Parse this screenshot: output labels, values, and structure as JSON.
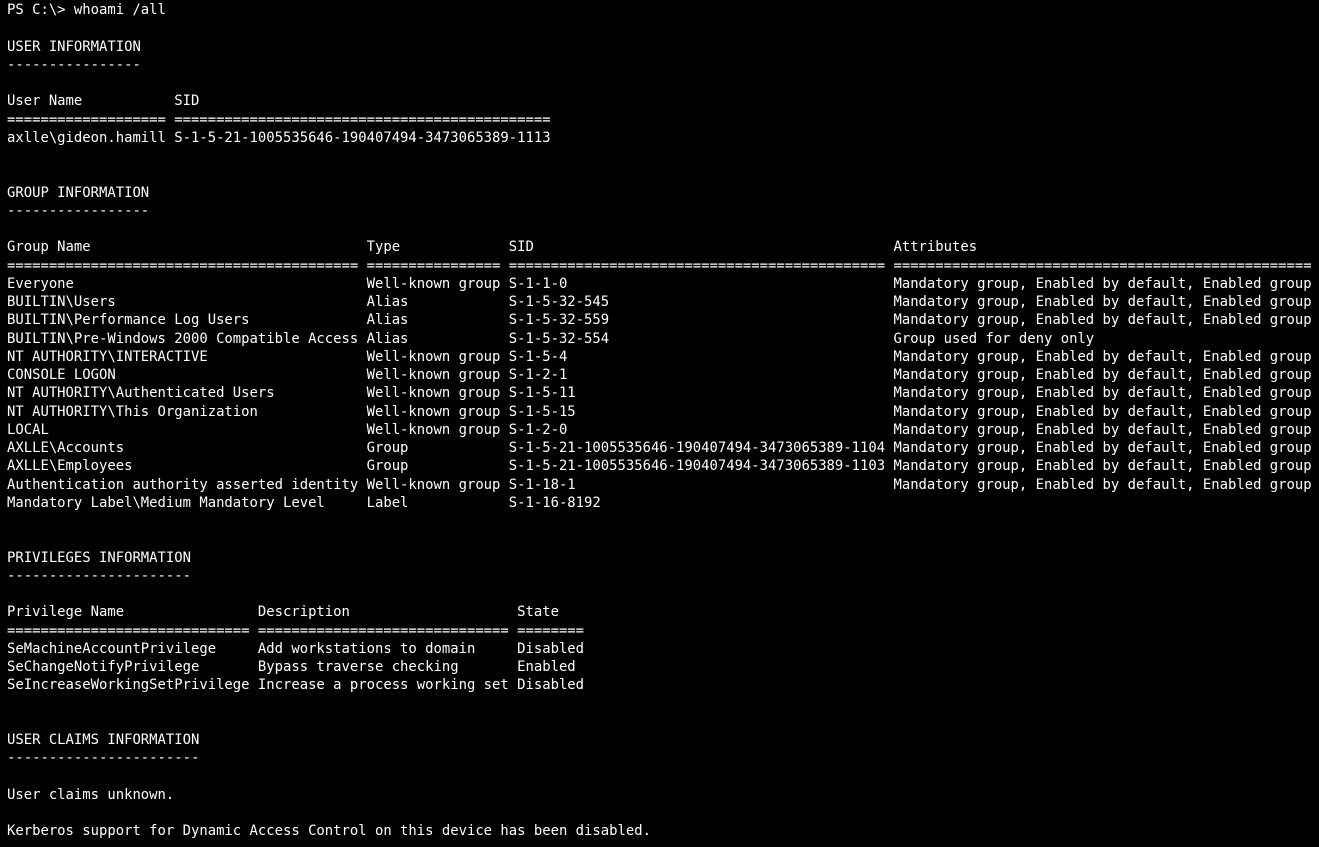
{
  "theme": {
    "background": "#000000",
    "foreground": "#ffffff"
  },
  "lines": [
    "PS C:\\> whoami /all",
    "",
    "USER INFORMATION",
    "----------------",
    "",
    "User Name           SID",
    "=================== =============================================",
    "axlle\\gideon.hamill S-1-5-21-1005535646-190407494-3473065389-1113",
    "",
    "",
    "GROUP INFORMATION",
    "-----------------",
    "",
    "Group Name                                 Type             SID                                           Attributes",
    "========================================== ================ ============================================= ==================================================",
    "Everyone                                   Well-known group S-1-1-0                                       Mandatory group, Enabled by default, Enabled group",
    "BUILTIN\\Users                              Alias            S-1-5-32-545                                  Mandatory group, Enabled by default, Enabled group",
    "BUILTIN\\Performance Log Users              Alias            S-1-5-32-559                                  Mandatory group, Enabled by default, Enabled group",
    "BUILTIN\\Pre-Windows 2000 Compatible Access Alias            S-1-5-32-554                                  Group used for deny only",
    "NT AUTHORITY\\INTERACTIVE                   Well-known group S-1-5-4                                       Mandatory group, Enabled by default, Enabled group",
    "CONSOLE LOGON                              Well-known group S-1-2-1                                       Mandatory group, Enabled by default, Enabled group",
    "NT AUTHORITY\\Authenticated Users           Well-known group S-1-5-11                                      Mandatory group, Enabled by default, Enabled group",
    "NT AUTHORITY\\This Organization             Well-known group S-1-5-15                                      Mandatory group, Enabled by default, Enabled group",
    "LOCAL                                      Well-known group S-1-2-0                                       Mandatory group, Enabled by default, Enabled group",
    "AXLLE\\Accounts                             Group            S-1-5-21-1005535646-190407494-3473065389-1104 Mandatory group, Enabled by default, Enabled group",
    "AXLLE\\Employees                            Group            S-1-5-21-1005535646-190407494-3473065389-1103 Mandatory group, Enabled by default, Enabled group",
    "Authentication authority asserted identity Well-known group S-1-18-1                                      Mandatory group, Enabled by default, Enabled group",
    "Mandatory Label\\Medium Mandatory Level     Label            S-1-16-8192",
    "",
    "",
    "PRIVILEGES INFORMATION",
    "----------------------",
    "",
    "Privilege Name                Description                    State",
    "============================= ============================== ========",
    "SeMachineAccountPrivilege     Add workstations to domain     Disabled",
    "SeChangeNotifyPrivilege       Bypass traverse checking       Enabled",
    "SeIncreaseWorkingSetPrivilege Increase a process working set Disabled",
    "",
    "",
    "USER CLAIMS INFORMATION",
    "-----------------------",
    "",
    "User claims unknown.",
    "",
    "Kerberos support for Dynamic Access Control on this device has been disabled."
  ]
}
